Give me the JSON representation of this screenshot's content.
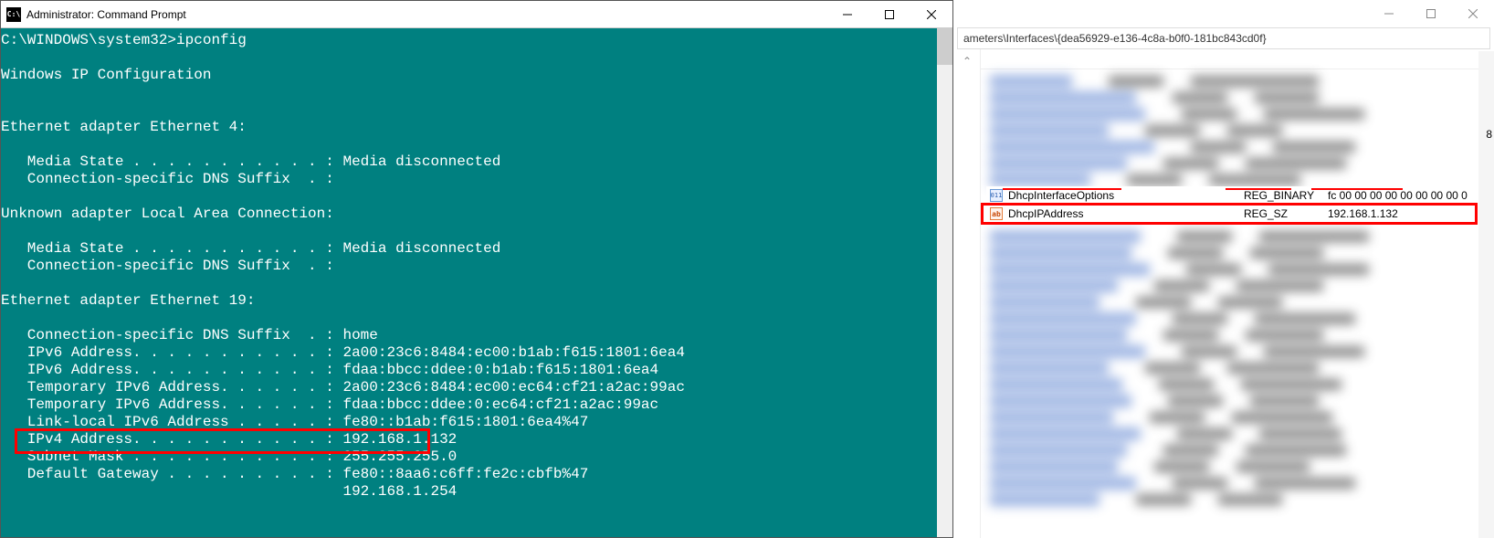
{
  "cmd": {
    "title": "Administrator: Command Prompt",
    "icon_label": "C:\\",
    "prompt": "C:\\WINDOWS\\system32>",
    "command": "ipconfig",
    "sections": {
      "ip_config_heading": "Windows IP Configuration",
      "adapter_eth4_heading": "Ethernet adapter Ethernet 4:",
      "adapter_unknown_heading": "Unknown adapter Local Area Connection:",
      "adapter_eth19_heading": "Ethernet adapter Ethernet 19:"
    },
    "lines": {
      "media_state": "   Media State . . . . . . . . . . . : Media disconnected",
      "dns_suffix_empty": "   Connection-specific DNS Suffix  . :",
      "dns_suffix_home": "   Connection-specific DNS Suffix  . : home",
      "ipv6_1": "   IPv6 Address. . . . . . . . . . . : 2a00:23c6:8484:ec00:b1ab:f615:1801:6ea4",
      "ipv6_2": "   IPv6 Address. . . . . . . . . . . : fdaa:bbcc:ddee:0:b1ab:f615:1801:6ea4",
      "tmp_ipv6_1": "   Temporary IPv6 Address. . . . . . : 2a00:23c6:8484:ec00:ec64:cf21:a2ac:99ac",
      "tmp_ipv6_2": "   Temporary IPv6 Address. . . . . . : fdaa:bbcc:ddee:0:ec64:cf21:a2ac:99ac",
      "link_local": "   Link-local IPv6 Address . . . . . : fe80::b1ab:f615:1801:6ea4%47",
      "ipv4": "   IPv4 Address. . . . . . . . . . . : 192.168.1.132",
      "subnet": "   Subnet Mask . . . . . . . . . . . : 255.255.255.0",
      "gateway1": "   Default Gateway . . . . . . . . . : fe80::8aa6:c6ff:fe2c:cbfb%47",
      "gateway2": "                                       192.168.1.254"
    }
  },
  "registry": {
    "address": "ameters\\Interfaces\\{dea56929-e136-4c8a-b0f0-181bc843cd0f}",
    "clear_rows": [
      {
        "icon": "bin",
        "name": "DhcpInterfaceOptions",
        "type": "REG_BINARY",
        "data": "fc 00 00 00 00 00 00 00 00 0"
      },
      {
        "icon": "sz",
        "name": "DhcpIPAddress",
        "type": "REG_SZ",
        "data": "192.168.1.132"
      }
    ],
    "trailing_char": "8"
  }
}
